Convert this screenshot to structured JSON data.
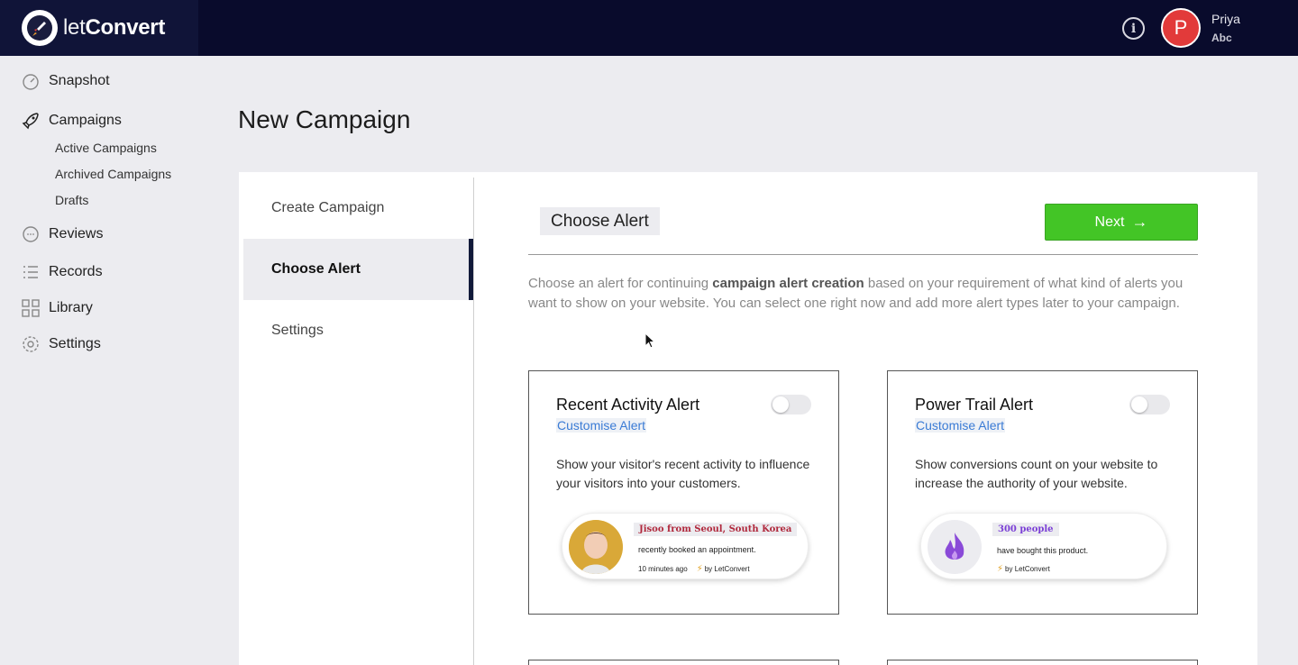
{
  "brand": {
    "name_light": "let",
    "name_bold": "Convert"
  },
  "header": {
    "info_icon": "info-icon",
    "avatar_letter": "P",
    "user_name": "Priya",
    "user_sub": "Abc"
  },
  "sidebar": {
    "snapshot": "Snapshot",
    "campaigns": "Campaigns",
    "campaign_subitems": [
      "Active Campaigns",
      "Archived Campaigns",
      "Drafts"
    ],
    "reviews": "Reviews",
    "records": "Records",
    "library": "Library",
    "settings": "Settings"
  },
  "page": {
    "title": "New Campaign"
  },
  "steps": [
    "Create Campaign",
    "Choose Alert",
    "Settings"
  ],
  "active_step": "Choose Alert",
  "content": {
    "section_title": "Choose Alert",
    "next_label": "Next",
    "description_pre": "Choose an alert for continuing ",
    "description_bold": "campaign alert creation",
    "description_post": " based on your requirement of what kind of alerts you want to show on your website. You can select one right now and add more alert types later to your campaign."
  },
  "alerts": [
    {
      "title": "Recent Activity Alert",
      "customise": "Customise Alert",
      "enabled": false,
      "description": "Show your visitor's recent activity to influence your visitors into your customers.",
      "preview": {
        "headline": "Jisoo from Seoul, South Korea",
        "line": "recently booked an appointment.",
        "time": "10 minutes ago",
        "by": "by LetConvert",
        "headline_color": "#b0283c"
      }
    },
    {
      "title": "Power Trail Alert",
      "customise": "Customise Alert",
      "enabled": false,
      "description": "Show conversions count on your website to increase the authority of your website.",
      "preview": {
        "headline": "300 people",
        "line": "have bought this product.",
        "by": "by LetConvert",
        "headline_color": "#7b3fd6"
      }
    }
  ],
  "colors": {
    "topbar": "#090b2c",
    "accent_green": "#43c526",
    "link_blue": "#3a7bd5",
    "avatar_red": "#e23a3a"
  }
}
